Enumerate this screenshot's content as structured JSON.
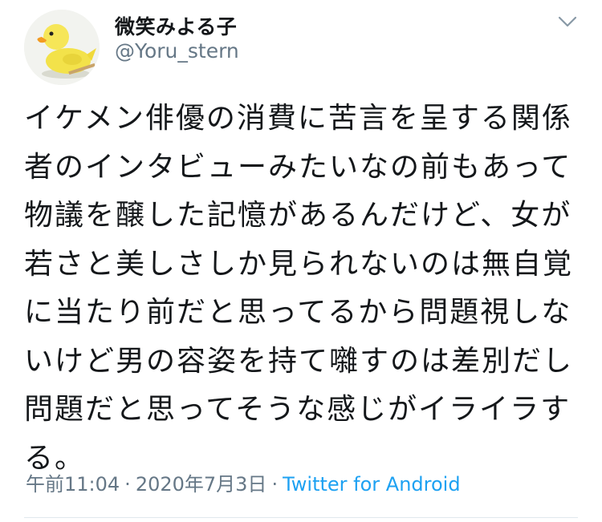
{
  "user": {
    "display_name": "微笑みよる子",
    "handle": "@Yoru_stern"
  },
  "tweet": {
    "text": "イケメン俳優の消費に苦言を呈する関係者のインタビューみたいなの前もあって物議を醸した記憶があるんだけど、女が若さと美しさしか見られないのは無自覚に当たり前だと思ってるから問題視しないけど男の容姿を持て囃すのは差別だし問題だと思ってそうな感じがイライラする。"
  },
  "meta": {
    "time": "午前11:04",
    "date": "2020年7月3日",
    "separator": "·",
    "source": "Twitter for Android"
  },
  "icons": {
    "avatar": "rubber-duck-avatar",
    "more": "chevron-down-icon"
  },
  "colors": {
    "text": "#14171a",
    "secondary": "#657786",
    "link": "#1da1f2"
  }
}
